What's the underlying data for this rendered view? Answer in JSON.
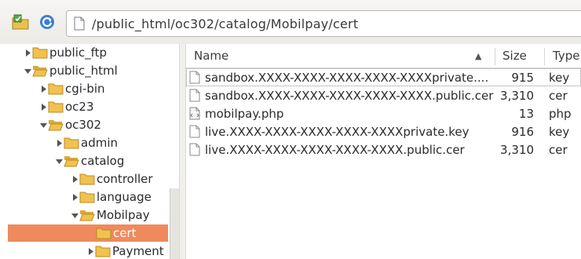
{
  "toolbar": {
    "path": "/public_html/oc302/catalog/Mobilpay/cert"
  },
  "tree": {
    "items": [
      {
        "label": "public_ftp",
        "expanded": false
      },
      {
        "label": "public_html",
        "expanded": true
      },
      {
        "label": "cgi-bin",
        "expanded": false
      },
      {
        "label": "oc23",
        "expanded": false
      },
      {
        "label": "oc302",
        "expanded": true
      },
      {
        "label": "admin",
        "expanded": false
      },
      {
        "label": "catalog",
        "expanded": true
      },
      {
        "label": "controller",
        "expanded": false
      },
      {
        "label": "language",
        "expanded": false
      },
      {
        "label": "Mobilpay",
        "expanded": true
      },
      {
        "label": "cert",
        "selected": true
      },
      {
        "label": "Payment",
        "expanded": false
      }
    ]
  },
  "files": {
    "columns": {
      "name": "Name",
      "size": "Size",
      "type": "Type"
    },
    "sort_indicator": "▲",
    "rows": [
      {
        "name": "sandbox.XXXX-XXXX-XXXX-XXXX-XXXXprivate....",
        "size": "915",
        "type": "key",
        "icon": "document-icon"
      },
      {
        "name": "sandbox.XXXX-XXXX-XXXX-XXXX-XXXX.public.cer",
        "size": "3,310",
        "type": "cer",
        "icon": "document-icon"
      },
      {
        "name": "mobilpay.php",
        "size": "13",
        "type": "php",
        "icon": "code-file-icon"
      },
      {
        "name": "live.XXXX-XXXX-XXXX-XXXX-XXXXprivate.key",
        "size": "916",
        "type": "key",
        "icon": "document-icon"
      },
      {
        "name": "live.XXXX-XXXX-XXXX-XXXX-XXXX.public.cer",
        "size": "3,310",
        "type": "cer",
        "icon": "document-icon"
      }
    ]
  },
  "colors": {
    "selection": "#ef8a5c",
    "folder": "#f2c14e"
  }
}
